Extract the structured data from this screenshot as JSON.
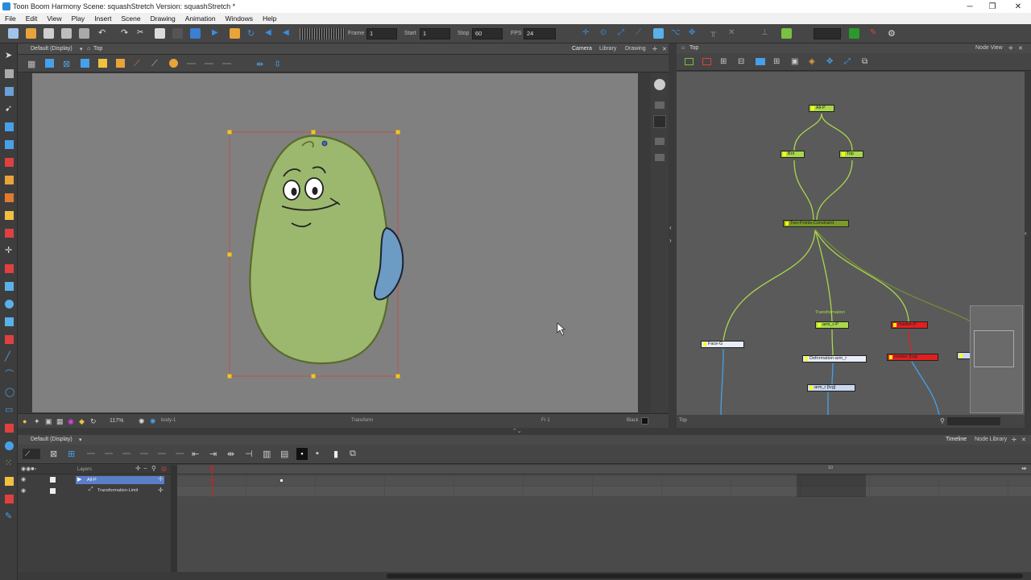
{
  "window": {
    "title": "Toon Boom Harmony Scene: squashStretch Version: squashStretch *",
    "minimize": "─",
    "maximize": "❐",
    "close": "✕"
  },
  "menu": [
    "File",
    "Edit",
    "View",
    "Play",
    "Insert",
    "Scene",
    "Drawing",
    "Animation",
    "Windows",
    "Help"
  ],
  "toolbar": {
    "frame_label": "Frame",
    "frame_value": "1",
    "start_label": "Start",
    "start_value": "1",
    "stop_label": "Stop",
    "stop_value": "60",
    "fps_label": "FPS",
    "fps_value": "24"
  },
  "camera_view": {
    "view_mode": "Default (Display)",
    "view_name": "Top",
    "tabs": [
      "Camera",
      "Library",
      "Drawing"
    ],
    "zoom": "117%",
    "drawing_name": "body-1",
    "tool_mode": "Transform",
    "frame_indicator": "Fr 1",
    "color_name": "Black"
  },
  "node_view": {
    "panel_title": "Top",
    "tab": "Node View",
    "status": "Top",
    "nodes": {
      "all_p": "All-P",
      "bot": "Bot",
      "top": "Top",
      "constraint": "Two-Points-Constraint",
      "transformation_label": "Transformation",
      "arm_r_p": "arm_r-P",
      "face_g": "Face-G",
      "deformation": "Deformation-arm_r",
      "arm_r_tvg": "arm_r [tvg]",
      "red1": "marker-P",
      "red2": "marker [tvg]"
    }
  },
  "timeline": {
    "view_mode": "Default (Display)",
    "tabs": [
      "Timeline",
      "Node Library"
    ],
    "layers_header": "Layers",
    "layers": [
      {
        "name": "All-P"
      },
      {
        "name": "Transformation-Limit"
      }
    ],
    "frame_marker": "10"
  },
  "colors": {
    "accent": "#2a8cd8",
    "node_green": "#a8d84a",
    "node_red": "#e02020",
    "body_green": "#9cb86f",
    "arm_blue": "#6c9bc4"
  }
}
